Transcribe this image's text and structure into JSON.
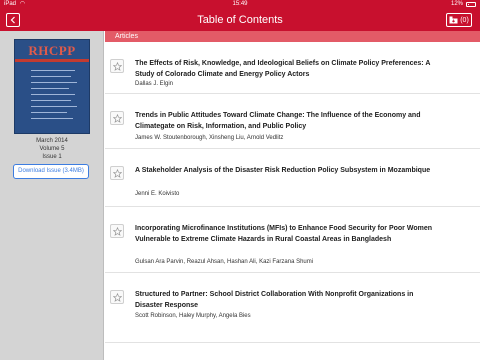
{
  "status_bar": {
    "carrier": "iPad",
    "time": "15:49",
    "battery": "12%"
  },
  "nav": {
    "title": "Table of Contents",
    "download_count": "(0)",
    "icons": {
      "back": "chevron-left-icon",
      "downloads": "download-box-icon",
      "star": "star-icon"
    }
  },
  "issue": {
    "cover_title": "RHCPP",
    "date": "March 2014",
    "volume": "Volume 5",
    "number": "Issue 1",
    "download_label": "Download Issue (3.4MB)"
  },
  "section": {
    "label": "Articles"
  },
  "articles": [
    {
      "title": "The Effects of Risk, Knowledge, and Ideological Beliefs on Climate Policy Preferences: A Study of Colorado Climate and Energy Policy Actors",
      "authors": "Dallas J. Elgin"
    },
    {
      "title": "Trends in Public Attitudes Toward Climate Change: The Influence of the Economy and Climategate on Risk, Information, and Public Policy",
      "authors": "James W. Stoutenborough, Xinsheng Liu, Arnold Vedlitz"
    },
    {
      "title": "A Stakeholder Analysis of the Disaster Risk Reduction Policy Subsystem in Mozambique",
      "authors": "Jenni E. Koivisto"
    },
    {
      "title": "Incorporating Microfinance Institutions (MFIs) to Enhance Food Security for Poor Women Vulnerable to Extreme Climate Hazards in Rural Coastal Areas in Bangladesh",
      "authors": "Gulsan Ara Parvin, Reazul Ahsan, Hashan Ali, Kazi Farzana Shumi"
    },
    {
      "title": "Structured to Partner: School District Collaboration With Nonprofit Organizations in Disaster Response",
      "authors": "Scott Robinson, Haley Murphy, Angela Bies"
    }
  ],
  "colors": {
    "accent": "#c8102e",
    "section_header": "#e35b67",
    "link": "#3d7de0",
    "sidebar": "#d4d4d4"
  }
}
